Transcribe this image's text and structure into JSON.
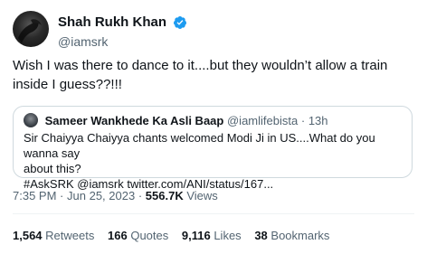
{
  "author": {
    "display_name": "Shah Rukh Khan",
    "handle": "@iamsrk",
    "verified_color": "#1d9bf0"
  },
  "tweet": {
    "text": "Wish I was there to dance to it....but they wouldn’t allow a train inside I guess??!!!"
  },
  "quoted_tweet": {
    "display_name": "Sameer Wankhede Ka Asli Baap",
    "handle": "@iamlifebista",
    "separator": "·",
    "time": "13h",
    "text_line1": "Sir Chaiyya  Chaiyya chants welcomed Modi Ji in US....What do you wanna say",
    "text_line2": "about this?",
    "text_line3": "#AskSRK @iamsrk twitter.com/ANI/status/167..."
  },
  "meta": {
    "time": "7:35 PM",
    "date": "Jun 25, 2023",
    "separator": "·",
    "views_count": "556.7K",
    "views_label": "Views"
  },
  "stats": {
    "retweets_count": "1,564",
    "retweets_label": "Retweets",
    "quotes_count": "166",
    "quotes_label": "Quotes",
    "likes_count": "9,116",
    "likes_label": "Likes",
    "bookmarks_count": "38",
    "bookmarks_label": "Bookmarks"
  }
}
